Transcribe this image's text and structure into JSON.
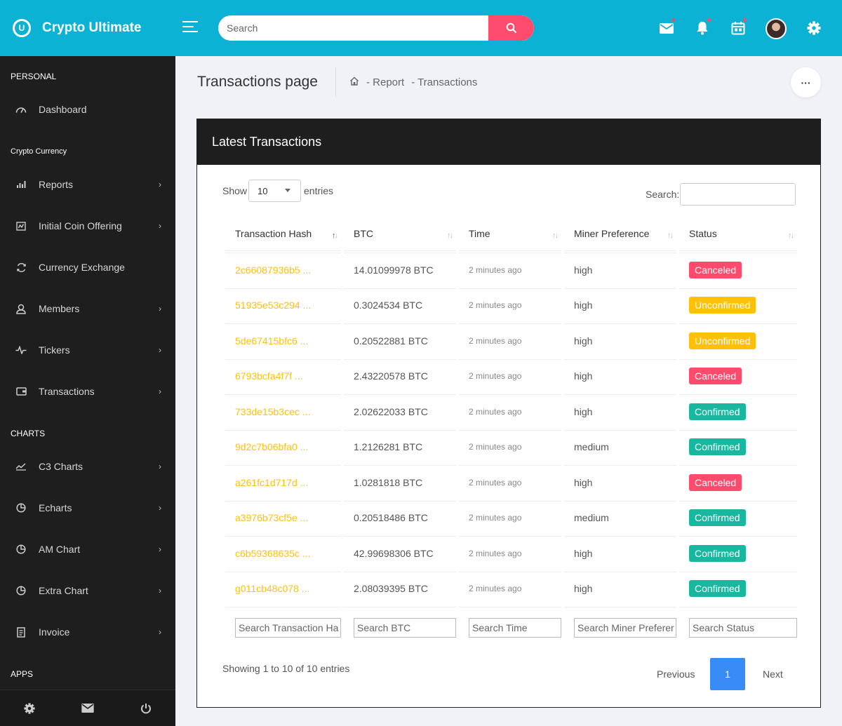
{
  "app": {
    "name": "Crypto Ultimate",
    "logo_letter": "U"
  },
  "header": {
    "search_placeholder": "Search"
  },
  "sidebar": {
    "sections": [
      "PERSONAL",
      "Crypto Currency",
      "CHARTS",
      "APPS"
    ],
    "items": [
      {
        "label": "Dashboard",
        "icon": "speedometer-icon"
      },
      {
        "label": "Reports",
        "icon": "bar-chart-icon"
      },
      {
        "label": "Initial Coin Offering",
        "icon": "coin-chart-icon"
      },
      {
        "label": "Currency Exchange",
        "icon": "exchange-icon"
      },
      {
        "label": "Members",
        "icon": "user-icon"
      },
      {
        "label": "Tickers",
        "icon": "pulse-icon"
      },
      {
        "label": "Transactions",
        "icon": "wallet-icon"
      },
      {
        "label": "C3 Charts",
        "icon": "line-chart-icon"
      },
      {
        "label": "Echarts",
        "icon": "pie-chart-icon"
      },
      {
        "label": "AM Chart",
        "icon": "pie-chart-icon"
      },
      {
        "label": "Extra Chart",
        "icon": "pie-chart-icon"
      },
      {
        "label": "Invoice",
        "icon": "invoice-icon"
      }
    ]
  },
  "page": {
    "title": "Transactions page",
    "breadcrumb": [
      "- Report",
      "- Transactions"
    ]
  },
  "box": {
    "title": "Latest Transactions",
    "show_label": "Show",
    "entries_label": "entries",
    "page_length": "10",
    "search_label": "Search:",
    "columns": [
      "Transaction Hash",
      "BTC",
      "Time",
      "Miner Preference",
      "Status"
    ],
    "rows": [
      {
        "hash": "2c66087936b5 ...",
        "btc": "14.01099978 BTC",
        "time": "2 minutes ago",
        "miner": "high",
        "status": "Canceled"
      },
      {
        "hash": "51935e53c294 ...",
        "btc": "0.3024534 BTC",
        "time": "2 minutes ago",
        "miner": "high",
        "status": "Unconfirmed"
      },
      {
        "hash": "5de67415bfc6 ...",
        "btc": "0.20522881 BTC",
        "time": "2 minutes ago",
        "miner": "high",
        "status": "Unconfirmed"
      },
      {
        "hash": "6793bcfa4f7f ...",
        "btc": "2.43220578 BTC",
        "time": "2 minutes ago",
        "miner": "high",
        "status": "Canceled"
      },
      {
        "hash": "733de15b3cec ...",
        "btc": "2.02622033 BTC",
        "time": "2 minutes ago",
        "miner": "high",
        "status": "Confirmed"
      },
      {
        "hash": "9d2c7b06bfa0 ...",
        "btc": "1.2126281 BTC",
        "time": "2 minutes ago",
        "miner": "medium",
        "status": "Confirmed"
      },
      {
        "hash": "a261fc1d717d ...",
        "btc": "1.0281818 BTC",
        "time": "2 minutes ago",
        "miner": "high",
        "status": "Canceled"
      },
      {
        "hash": "a3976b73cf5e ...",
        "btc": "0.20518486 BTC",
        "time": "2 minutes ago",
        "miner": "medium",
        "status": "Confirmed"
      },
      {
        "hash": "c6b59368635c ...",
        "btc": "42.99698306 BTC",
        "time": "2 minutes ago",
        "miner": "high",
        "status": "Confirmed"
      },
      {
        "hash": "g011cb48c078 ...",
        "btc": "2.08039395 BTC",
        "time": "2 minutes ago",
        "miner": "high",
        "status": "Confirmed"
      }
    ],
    "filters": [
      "Search Transaction Ha",
      "Search BTC",
      "Search Time",
      "Search Miner Preferer",
      "Search Status"
    ],
    "info": "Showing 1 to 10 of 10 entries",
    "pagination": {
      "previous": "Previous",
      "current": "1",
      "next": "Next"
    }
  },
  "colors": {
    "accent": "#0bb2d4",
    "sidebar": "#1e1e1e",
    "danger": "#fc4b6c",
    "warning": "#ffc107",
    "success": "#1ab7a0",
    "primary": "#398bf7"
  }
}
